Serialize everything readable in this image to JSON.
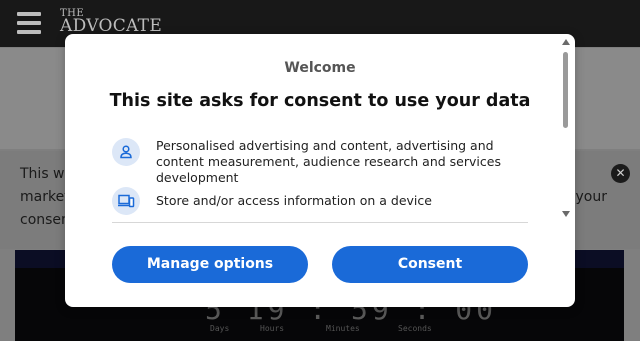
{
  "site": {
    "logo_line1": "THE",
    "logo_line2": "ADVOCATE"
  },
  "notice": {
    "line1": "This we",
    "line2": "market",
    "line3": "consen",
    "line2_right": "your"
  },
  "countdown": {
    "display": "5 19 : 59 : 00",
    "labels": [
      "Days",
      "Hours",
      "Minutes",
      "Seconds"
    ]
  },
  "consent_modal": {
    "welcome": "Welcome",
    "headline": "This site asks for consent to use your data",
    "purposes": [
      {
        "icon": "person-icon",
        "text": "Personalised advertising and content, advertising and content measurement, audience research and services development"
      },
      {
        "icon": "devices-icon",
        "text": "Store and/or access information on a device"
      }
    ],
    "manage_label": "Manage options",
    "consent_label": "Consent"
  },
  "colors": {
    "accent": "#1a6ad8",
    "icon_bg": "#dce7f7",
    "topbar": "#181818"
  }
}
